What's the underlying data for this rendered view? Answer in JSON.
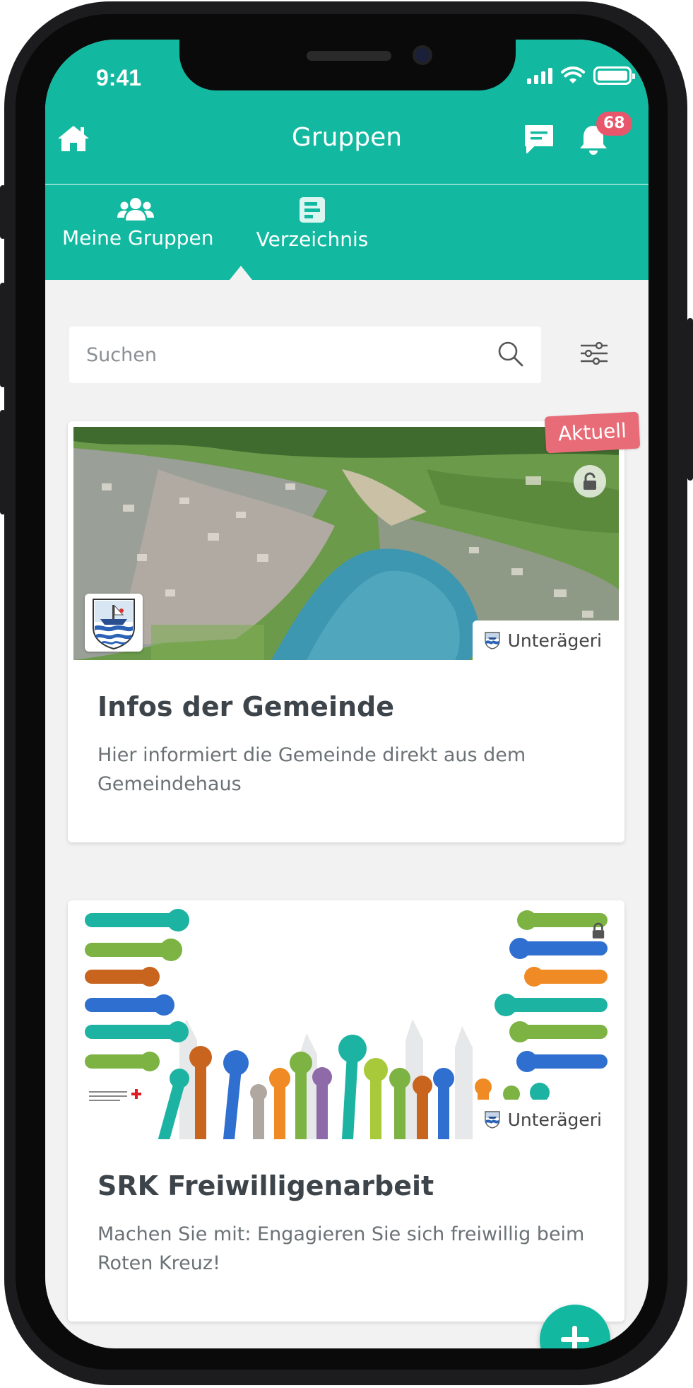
{
  "status_bar": {
    "time": "9:41"
  },
  "header": {
    "title": "Gruppen",
    "notification_count": "68"
  },
  "tabs": [
    {
      "label": "Meine Gruppen",
      "icon": "users-icon"
    },
    {
      "label": "Verzeichnis",
      "icon": "directory-icon"
    }
  ],
  "search": {
    "placeholder": "Suchen"
  },
  "groups": [
    {
      "badge": "Aktuell",
      "location": "Unterägeri",
      "title": "Infos der Gemeinde",
      "description": "Hier informiert die Gemeinde direkt aus dem Gemeindehaus",
      "locked": true
    },
    {
      "location": "Unterägeri",
      "title": "SRK Freiwilligenarbeit",
      "description": "Machen Sie mit: Engagieren Sie sich freiwillig beim Roten Kreuz!",
      "locked": true
    }
  ],
  "colors": {
    "primary": "#12b9a0",
    "badge_red": "#e86c77",
    "notification_red": "#e8566c",
    "background": "#f2f2f2"
  }
}
